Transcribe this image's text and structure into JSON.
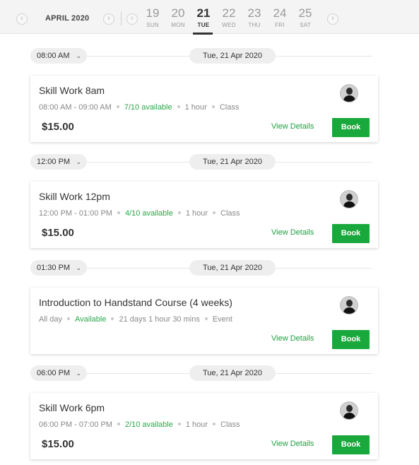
{
  "header": {
    "prev_month_icon": "chevron-left-icon",
    "next_month_icon": "chevron-right-icon",
    "month_label": "APRIL 2020",
    "prev_week_icon": "chevron-left-icon",
    "next_week_icon": "chevron-right-icon",
    "days": [
      {
        "num": "19",
        "dow": "SUN",
        "selected": false
      },
      {
        "num": "20",
        "dow": "MON",
        "selected": false
      },
      {
        "num": "21",
        "dow": "TUE",
        "selected": true
      },
      {
        "num": "22",
        "dow": "WED",
        "selected": false
      },
      {
        "num": "23",
        "dow": "THU",
        "selected": false
      },
      {
        "num": "24",
        "dow": "FRI",
        "selected": false
      },
      {
        "num": "25",
        "dow": "SAT",
        "selected": false
      }
    ]
  },
  "sessions": [
    {
      "time": "08:00 AM",
      "date": "Tue, 21 Apr 2020",
      "title": "Skill Work 8am",
      "range": "08:00 AM - 09:00 AM",
      "availability": "7/10 available",
      "duration": "1 hour",
      "kind": "Class",
      "price": "$15.00",
      "view_label": "View Details",
      "book_label": "Book"
    },
    {
      "time": "12:00 PM",
      "date": "Tue, 21 Apr 2020",
      "title": "Skill Work 12pm",
      "range": "12:00 PM - 01:00 PM",
      "availability": "4/10 available",
      "duration": "1 hour",
      "kind": "Class",
      "price": "$15.00",
      "view_label": "View Details",
      "book_label": "Book"
    },
    {
      "time": "01:30 PM",
      "date": "Tue, 21 Apr 2020",
      "title": "Introduction to Handstand Course (4 weeks)",
      "range": "All day",
      "availability": "Available",
      "duration": "21 days 1 hour 30 mins",
      "kind": "Event",
      "price": "",
      "view_label": "View Details",
      "book_label": "Book"
    },
    {
      "time": "06:00 PM",
      "date": "Tue, 21 Apr 2020",
      "title": "Skill Work 6pm",
      "range": "06:00 PM - 07:00 PM",
      "availability": "2/10 available",
      "duration": "1 hour",
      "kind": "Class",
      "price": "$15.00",
      "view_label": "View Details",
      "book_label": "Book"
    }
  ],
  "colors": {
    "accent_green": "#19a83b",
    "available_text": "#2aa74a"
  }
}
